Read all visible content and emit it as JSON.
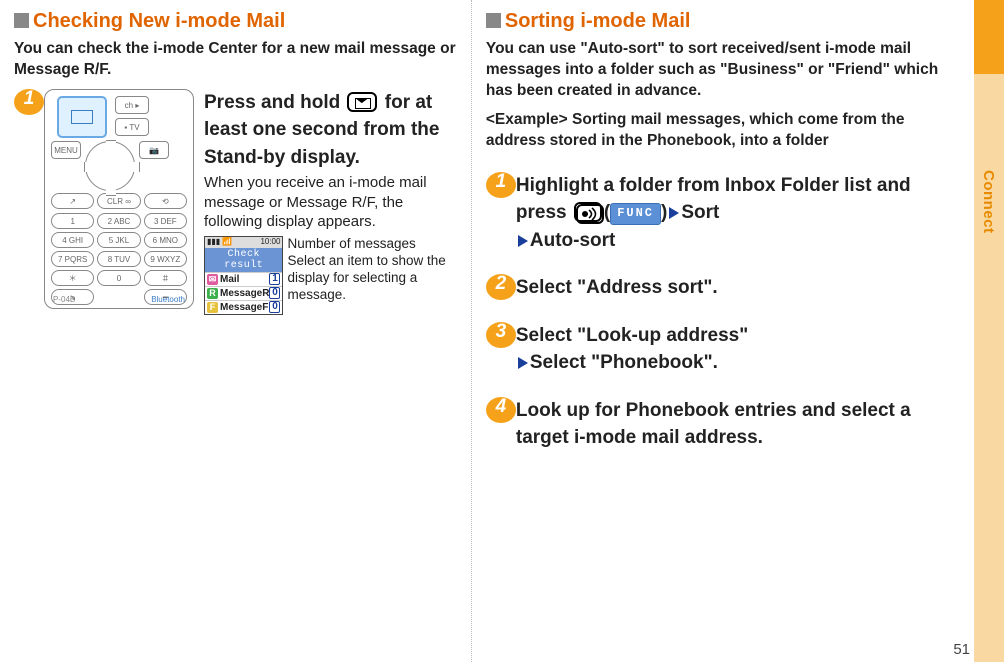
{
  "sidebar": {
    "label": "Connect"
  },
  "pagenum": "51",
  "left": {
    "heading": "Checking New i-mode Mail",
    "intro": "You can check the i-mode Center for a new mail message or Message R/F.",
    "step1": {
      "num": "1",
      "title_a": "Press and hold ",
      "title_b": " for at least one second from the Stand-by display.",
      "body": "When you receive an i-mode mail message or Message R/F, the following display appears."
    },
    "phone": {
      "model": "P-04B",
      "bt": "Bluetooth"
    },
    "result": {
      "status_time": "10:00",
      "bar": "Check result",
      "rows": {
        "mail": {
          "label": "Mail",
          "count": "1"
        },
        "r": {
          "label": "MessageR",
          "count": "0"
        },
        "f": {
          "label": "MessageF",
          "count": "0"
        }
      }
    },
    "notes": {
      "line1": "Number of messages",
      "line2": "Select an item to show the display for selecting a message."
    }
  },
  "right": {
    "heading": "Sorting i-mode Mail",
    "intro": "You can use \"Auto-sort\" to sort received/sent i-mode mail messages into a folder such as \"Business\" or \"Friend\" which has been created in advance.",
    "example_label": "<Example>",
    "example_text": "Sorting mail messages, which come from the address stored in the Phonebook, into a folder",
    "step1": {
      "num": "1",
      "line1a": "Highlight a folder from Inbox Folder list and press ",
      "func": "FUNC",
      "line1b": "Sort",
      "line2": "Auto-sort"
    },
    "step2": {
      "num": "2",
      "text": "Select \"Address sort\"."
    },
    "step3": {
      "num": "3",
      "line1": "Select \"Look-up address\"",
      "line2": "Select \"Phonebook\"."
    },
    "step4": {
      "num": "4",
      "text": "Look up for Phonebook entries and select a target i-mode mail address."
    }
  }
}
